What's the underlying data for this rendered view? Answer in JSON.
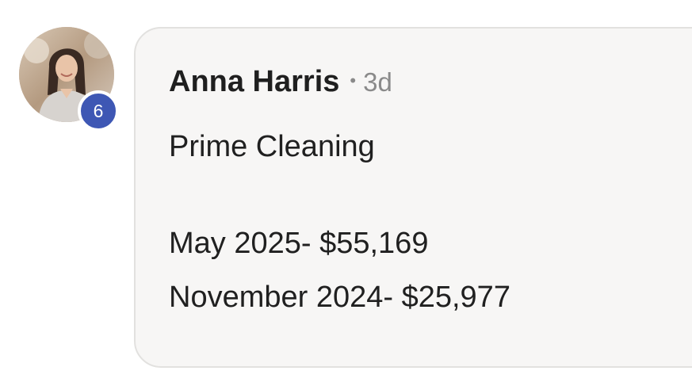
{
  "comment": {
    "author": {
      "name": "Anna Harris",
      "level_badge": "6"
    },
    "separator": "•",
    "timestamp": "3d",
    "lines": [
      "Prime Cleaning",
      "May 2025- $55,169",
      "November 2024- $25,977"
    ]
  },
  "colors": {
    "bubble_background": "#f7f6f5",
    "badge": "#3e57b4",
    "name_text": "#1f1f1f",
    "muted_text": "#8a8a8a"
  },
  "icons": {
    "avatar": "profile-photo"
  }
}
